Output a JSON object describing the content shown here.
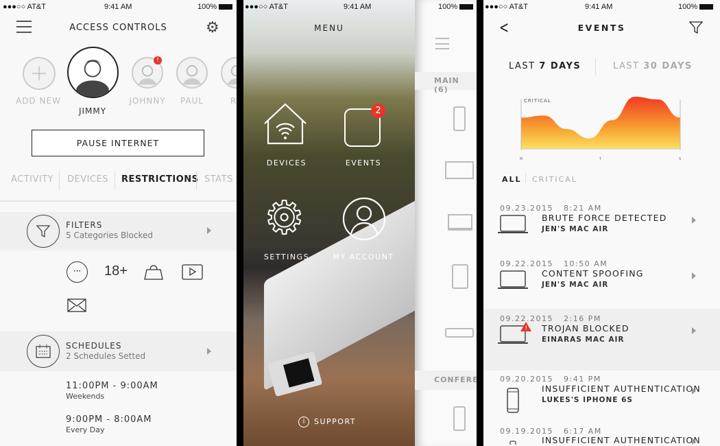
{
  "status_bar": {
    "carrier": "●●●○○ AT&T",
    "time": "9:41 AM",
    "battery": "100%"
  },
  "left": {
    "title": "ACCESS CONTROLS",
    "profiles": [
      {
        "name": "ADD NEW"
      },
      {
        "name": "JIMMY",
        "selected": true
      },
      {
        "name": "JOHNNY",
        "alert": true
      },
      {
        "name": "PAUL"
      },
      {
        "name": "RA"
      }
    ],
    "pause_button": "PAUSE INTERNET",
    "tabs": [
      "ACTIVITY",
      "DEVICES",
      "RESTRICTIONS",
      "STATS"
    ],
    "active_tab": "RESTRICTIONS",
    "filters": {
      "title": "FILTERS",
      "subtitle": "5 Categories Blocked",
      "icons": [
        "more-icon",
        "18+",
        "shopping-bag-icon",
        "video-icon",
        "mail-icon"
      ],
      "adult_label": "18+"
    },
    "schedules": {
      "title": "SCHEDULES",
      "subtitle": "2 Schedules Setted",
      "items": [
        {
          "time": "11:00PM - 9:00AM",
          "days": "Weekends"
        },
        {
          "time": "9:00PM - 8:00AM",
          "days": "Every Day"
        }
      ]
    }
  },
  "menu": {
    "title": "MENU",
    "items": [
      {
        "label": "DEVICES",
        "icon": "home-wifi-icon"
      },
      {
        "label": "EVENTS",
        "icon": "events-icon",
        "badge": "2"
      },
      {
        "label": "SETTINGS",
        "icon": "gear-icon"
      },
      {
        "label": "MY ACCOUNT",
        "icon": "user-circle-icon"
      }
    ],
    "support": "SUPPORT",
    "badge_color": "#e8342a"
  },
  "peek": {
    "battery": "100%",
    "section1": "MAIN (6)",
    "section2": "CONFERE"
  },
  "events": {
    "title": "EVENTS",
    "range_tabs": [
      {
        "pre": "LAST ",
        "num": "7",
        "post": " DAYS"
      },
      {
        "pre": "LAST ",
        "num": "30",
        "post": " DAYS"
      }
    ],
    "filter_tabs": [
      "ALL",
      "CRITICAL"
    ],
    "chart": {
      "label": "CRITICAL",
      "ticks": [
        "M",
        "T",
        "S"
      ],
      "levels": [
        0.6,
        0.64,
        0.38,
        0.2,
        0.55,
        1.0,
        0.95,
        0.6
      ],
      "colors": [
        "#f03a24",
        "#f7a030",
        "#fde060"
      ]
    },
    "list": [
      {
        "date": "09.23.2015",
        "time": "8:21 AM",
        "title": "BRUTE FORCE DETECTED",
        "device": "JEN'S MAC AIR",
        "icon": "laptop-icon"
      },
      {
        "date": "09.22.2015",
        "time": "10:50 AM",
        "title": "CONTENT SPOOFING",
        "device": "JEN'S MAC AIR",
        "icon": "laptop-icon"
      },
      {
        "date": "09.22.2015",
        "time": "2:16 PM",
        "title": "TROJAN BLOCKED",
        "device": "EINARAS MAC AIR",
        "icon": "laptop-alert-icon",
        "highlight": true
      },
      {
        "date": "09.20.2015",
        "time": "9:41 PM",
        "title": "INSUFFICIENT AUTHENTICATION",
        "device": "LUKES'S IPHONE 6S",
        "icon": "phone-icon"
      },
      {
        "date": "09.19.2015",
        "time": "6:17 AM",
        "title": "INSUFFICIENT AUTHENTICATION",
        "device": "",
        "icon": "phone-icon"
      }
    ]
  }
}
